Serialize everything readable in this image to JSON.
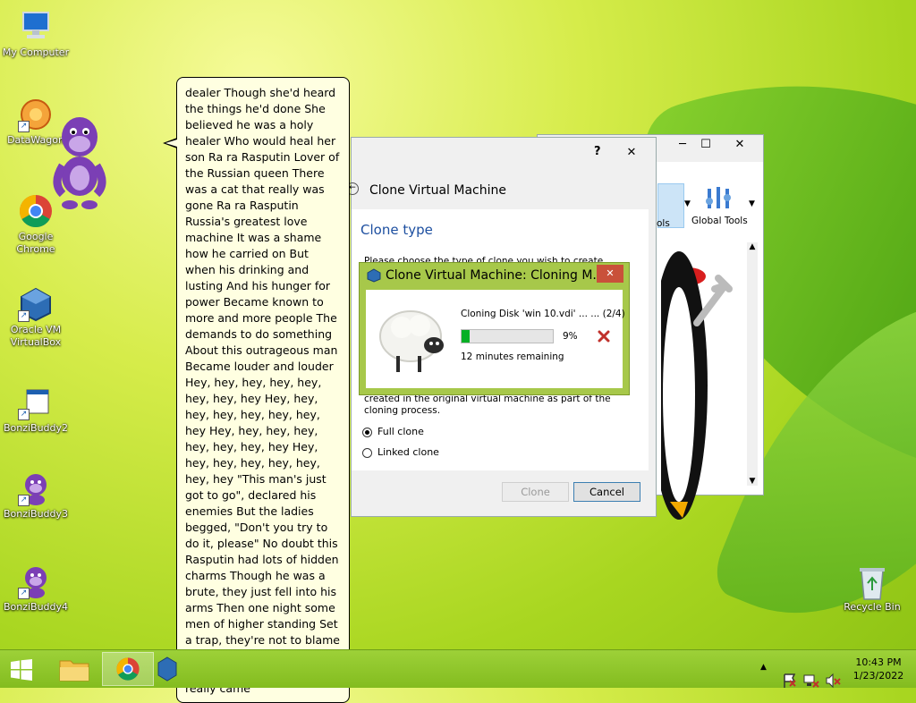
{
  "desktop": {
    "icons": [
      {
        "label": "My Computer"
      },
      {
        "label": "DataWagon"
      },
      {
        "label": "Google Chrome"
      },
      {
        "label": "Oracle VM VirtualBox"
      },
      {
        "label": "BonziBuddy2"
      },
      {
        "label": "BonziBuddy3"
      },
      {
        "label": "BonziBuddy4"
      },
      {
        "label": "Recycle Bin"
      }
    ]
  },
  "bonzi": {
    "speech": "dealer Though she'd heard the things he'd done She believed he was a holy healer Who would heal her son Ra ra Rasputin Lover of the Russian queen There was a cat that really was gone Ra ra Rasputin Russia's greatest love machine It was a shame how he carried on But when his drinking and lusting And his hunger for power Became known to more and more people The demands to do something About this outrageous man Became louder and louder Hey, hey, hey, hey, hey, hey, hey, hey Hey, hey, hey, hey, hey, hey, hey, hey Hey, hey, hey, hey, hey, hey, hey, hey Hey, hey, hey, hey, hey, hey, hey, hey \"This man's just got to go\", declared his enemies But the ladies begged, \"Don't you try to do it, please\" No doubt this Rasputin had lots of hidden charms Though he was a brute, they just fell into his arms Then one night some men of higher standing Set a trap, they're not to blame \"Come to visit us\", they kept demanding And he really came"
  },
  "virtualbox": {
    "tools_label_partial": "ols",
    "global_tools_label": "Global Tools"
  },
  "clone_dialog": {
    "help_glyph": "?",
    "close_glyph": "✕",
    "title": "Clone Virtual Machine",
    "section_title": "Clone type",
    "description_top": "Please choose the type of clone you wish to create.",
    "description_bottom": "created in the original virtual machine as part of the cloning process.",
    "option_full": "Full clone",
    "option_linked": "Linked clone",
    "clone_button": "Clone",
    "cancel_button": "Cancel"
  },
  "progress_dialog": {
    "title": "Clone Virtual Machine: Cloning M...",
    "status": "Cloning Disk 'win 10.vdi' ... ... (2/4)",
    "percent_label": "9%",
    "progress": 0.09,
    "remaining": "12 minutes remaining",
    "close_glyph": "✕"
  },
  "taskbar": {
    "time": "10:43 PM",
    "date": "1/23/2022"
  }
}
